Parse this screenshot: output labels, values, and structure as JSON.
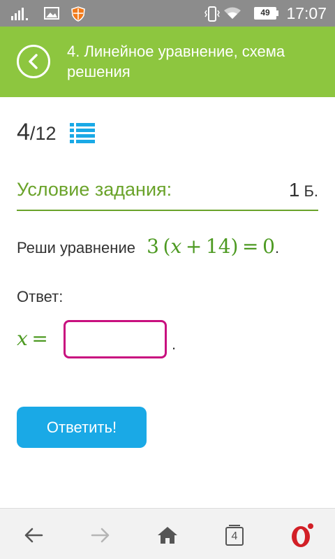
{
  "status_bar": {
    "time": "17:07",
    "battery_level": "49",
    "icons": [
      "signal-icon",
      "image-icon",
      "shield-icon",
      "vibrate-icon",
      "wifi-icon",
      "battery-icon"
    ]
  },
  "header": {
    "title": "4. Линейное уравнение, схема решения",
    "back_icon": "back-arrow-icon"
  },
  "progress": {
    "current": "4",
    "separator": "/",
    "total": "12"
  },
  "task": {
    "heading": "Условие задания:",
    "points_value": "1",
    "points_unit": "Б.",
    "prompt": "Реши уравнение",
    "equation_coef": "3",
    "equation_var": "x",
    "equation_const": "14",
    "equation_rhs": "0",
    "period": "."
  },
  "answer": {
    "label": "Ответ:",
    "variable": "x",
    "input_value": "",
    "period": "."
  },
  "submit": {
    "label": "Ответить!"
  },
  "bottom_nav": {
    "tabs_count": "4",
    "items": [
      "back-icon",
      "forward-icon",
      "home-icon",
      "tabs-icon",
      "opera-icon"
    ]
  },
  "colors": {
    "header_bg": "#8dc63f",
    "accent_green": "#6aa32a",
    "math_green": "#4d9a22",
    "input_border": "#c8107f",
    "button_bg": "#1aa9e6"
  }
}
